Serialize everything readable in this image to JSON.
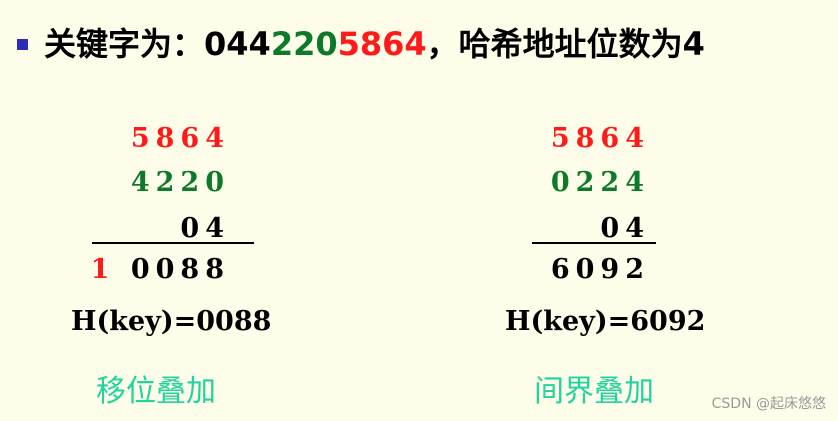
{
  "header": {
    "prefix": "关键字为：",
    "key_black": "044",
    "key_green": "220",
    "key_red": "5864",
    "suffix": "，哈希地址位数为4"
  },
  "left": {
    "rows": [
      "5864",
      "4220",
      "04"
    ],
    "result_carry": "1",
    "result_rest": "0088",
    "hkey": "H(key)=0088",
    "method": "移位叠加"
  },
  "right": {
    "rows": [
      "5864",
      "0224",
      "04"
    ],
    "result": "6092",
    "hkey": "H(key)=6092",
    "method": "间界叠加"
  },
  "watermark": "CSDN @起床悠悠",
  "colors": {
    "red": "#ff1a1a",
    "green": "#0d7a2a",
    "method": "#22d3a0",
    "bullet": "#2d2db6"
  }
}
